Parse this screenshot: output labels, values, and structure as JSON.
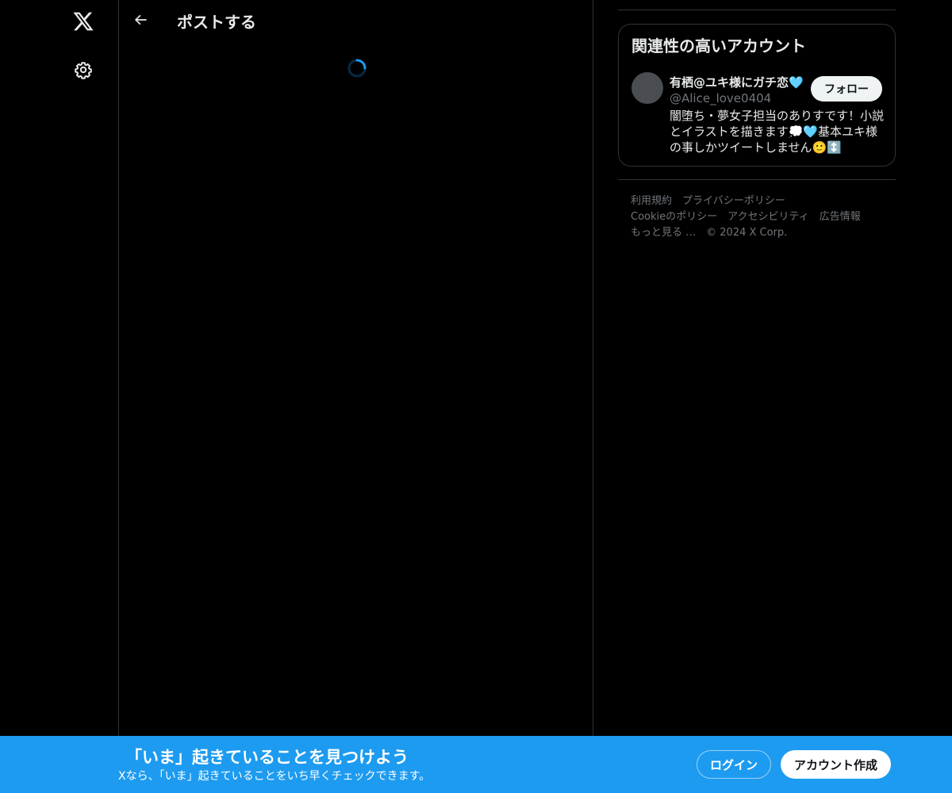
{
  "nav": {
    "logo_icon": "x-logo-icon",
    "settings_icon": "gear-icon"
  },
  "header": {
    "back_icon": "arrow-left-icon",
    "title": "ポストする"
  },
  "loading": {
    "spinner_icon": "loading-spinner-icon"
  },
  "sidebar": {
    "relevant_title": "関連性の高いアカウント",
    "account": {
      "name": "有栖@ユキ様にガチ恋🩵",
      "handle": "@Alice_love0404",
      "follow_label": "フォロー",
      "bio": "闇堕ち・夢女子担当のありすです！小説とイラストを描きます💭🩵基本ユキ様の事しかツイートしません🙂↕️"
    },
    "footer": {
      "links": [
        "利用規約",
        "プライバシーポリシー",
        "Cookieのポリシー",
        "アクセシビリティ",
        "広告情報",
        "もっと見る …"
      ],
      "copyright": "© 2024 X Corp."
    }
  },
  "banner": {
    "title": "「いま」起きていることを見つけよう",
    "subtitle": "Xなら、「いま」起きていることをいち早くチェックできます。",
    "login_label": "ログイン",
    "signup_label": "アカウント作成"
  },
  "colors": {
    "background": "#000000",
    "accent": "#1d9bf0",
    "text_primary": "#e7e9ea",
    "text_secondary": "#71767b",
    "border": "#2f3336"
  }
}
